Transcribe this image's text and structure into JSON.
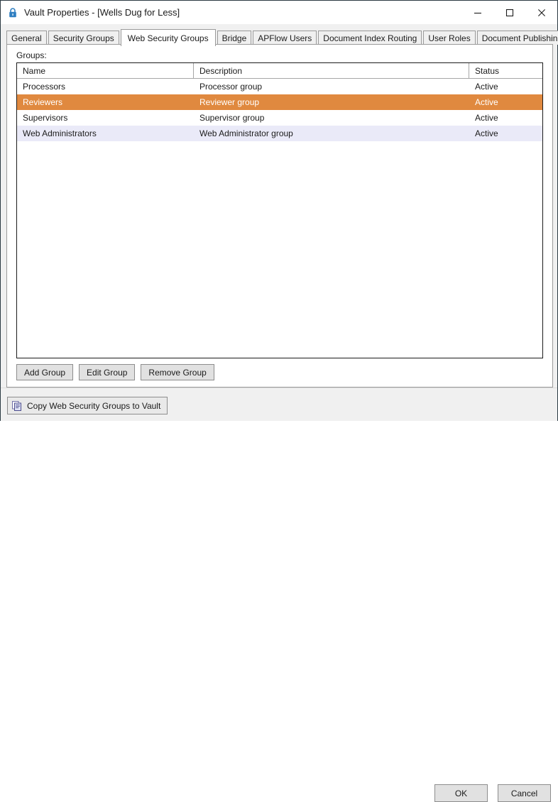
{
  "window": {
    "title": "Vault Properties - [Wells Dug for Less]",
    "lock_icon": "lock-icon",
    "controls": {
      "minimize": "minimize-icon",
      "maximize": "maximize-icon",
      "close": "close-icon"
    }
  },
  "tabs": [
    {
      "label": "General",
      "active": false
    },
    {
      "label": "Security Groups",
      "active": false
    },
    {
      "label": "Web Security Groups",
      "active": true
    },
    {
      "label": "Bridge",
      "active": false
    },
    {
      "label": "APFlow Users",
      "active": false
    },
    {
      "label": "Document Index Routing",
      "active": false
    },
    {
      "label": "User Roles",
      "active": false
    },
    {
      "label": "Document Publishing",
      "active": false
    }
  ],
  "page": {
    "groups_label": "Groups:",
    "grid": {
      "columns": [
        "Name",
        "Description",
        "Status"
      ],
      "rows": [
        {
          "name": "Processors",
          "description": "Processor group",
          "status": "Active",
          "state": "normal"
        },
        {
          "name": "Reviewers",
          "description": "Reviewer group",
          "status": "Active",
          "state": "selected"
        },
        {
          "name": "Supervisors",
          "description": "Supervisor group",
          "status": "Active",
          "state": "normal"
        },
        {
          "name": "Web Administrators",
          "description": "Web Administrator group",
          "status": "Active",
          "state": "highlight"
        }
      ]
    },
    "actions": {
      "add": "Add Group",
      "edit": "Edit Group",
      "remove": "Remove Group"
    }
  },
  "footer": {
    "copy_label": "Copy Web Security Groups to Vault",
    "copy_icon": "copy-icon",
    "ok": "OK",
    "cancel": "Cancel"
  },
  "colors": {
    "selection": "#e0893f",
    "row_highlight": "#eaeaf8",
    "dialog_bg": "#f0f0f0",
    "accent_lock": "#2f7fc1",
    "border": "#9a9a9a"
  }
}
